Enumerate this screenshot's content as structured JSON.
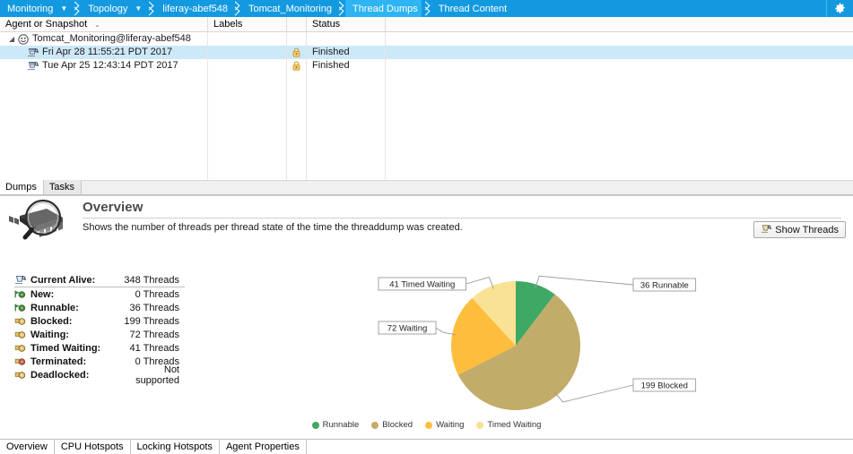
{
  "breadcrumb": {
    "items": [
      {
        "label": "Monitoring",
        "has_caret": true,
        "active": false
      },
      {
        "label": "Topology",
        "has_caret": true,
        "active": false
      },
      {
        "label": "liferay-abef548",
        "has_caret": false,
        "active": false
      },
      {
        "label": "Tomcat_Monitoring",
        "has_caret": false,
        "active": false
      },
      {
        "label": "Thread Dumps",
        "has_caret": false,
        "active": true
      },
      {
        "label": "Thread Content",
        "has_caret": false,
        "active": false
      }
    ],
    "settings_icon": "gear-icon",
    "bar_color": "#1399e0",
    "active_color": "#2eb4f2"
  },
  "table": {
    "columns": [
      "Agent or Snapshot",
      "Labels",
      "",
      "Status",
      ""
    ],
    "rows": [
      {
        "icon": "agent-icon",
        "name": "Tomcat_Monitoring@liferay-abef548",
        "labels": "",
        "lock": "",
        "status": "",
        "level": 0,
        "expanded": true,
        "selected": false
      },
      {
        "icon": "thread-dump-icon",
        "name": "Fri Apr 28 11:55:21 PDT 2017",
        "labels": "",
        "lock": "lock-icon",
        "status": "Finished",
        "level": 1,
        "expanded": false,
        "selected": true
      },
      {
        "icon": "thread-dump-icon",
        "name": "Tue Apr 25 12:43:14 PDT 2017",
        "labels": "",
        "lock": "lock-icon",
        "status": "Finished",
        "level": 1,
        "expanded": false,
        "selected": false
      }
    ],
    "empty_row_count": 8
  },
  "subtabs": [
    {
      "label": "Dumps",
      "active": true
    },
    {
      "label": "Tasks",
      "active": false
    }
  ],
  "overview": {
    "title": "Overview",
    "description": "Shows the number of threads per thread state of the time the threaddump was created.",
    "icon": "cpu-magnifier-icon",
    "show_threads_button": "Show Threads",
    "show_threads_icon": "thread-dump-icon",
    "stats": [
      {
        "icon": "thread-dump-icon",
        "label": "Current Alive:",
        "value": "348 Threads",
        "header": true
      },
      {
        "icon": "thread-new-icon",
        "label": "New:",
        "value": "0 Threads",
        "header": false
      },
      {
        "icon": "thread-runnable-icon",
        "label": "Runnable:",
        "value": "36 Threads",
        "header": false
      },
      {
        "icon": "thread-blocked-icon",
        "label": "Blocked:",
        "value": "199 Threads",
        "header": false
      },
      {
        "icon": "thread-waiting-icon",
        "label": "Waiting:",
        "value": "72 Threads",
        "header": false
      },
      {
        "icon": "thread-timed-icon",
        "label": "Timed Waiting:",
        "value": "41 Threads",
        "header": false
      },
      {
        "icon": "thread-terminated-icon",
        "label": "Terminated:",
        "value": "0 Threads",
        "header": false
      },
      {
        "icon": "thread-deadlock-icon",
        "label": "Deadlocked:",
        "value": "Not supported",
        "header": false
      }
    ]
  },
  "chart_data": {
    "type": "pie",
    "title": "",
    "categories": [
      "Runnable",
      "Blocked",
      "Waiting",
      "Timed Waiting"
    ],
    "values": [
      36,
      199,
      72,
      41
    ],
    "total": 348,
    "colors": [
      "#3fa864",
      "#c2ac6a",
      "#fcbe3c",
      "#fae295"
    ],
    "labels": [
      "36 Runnable",
      "199 Blocked",
      "72 Waiting",
      "41 Timed Waiting"
    ],
    "legend": [
      "Runnable",
      "Blocked",
      "Waiting",
      "Timed Waiting"
    ],
    "legend_position": "bottom",
    "start_angle": 0,
    "direction": "clockwise",
    "grid": false
  },
  "bottom_tabs": [
    {
      "label": "Overview",
      "active": true
    },
    {
      "label": "CPU Hotspots",
      "active": false
    },
    {
      "label": "Locking Hotspots",
      "active": false
    },
    {
      "label": "Agent Properties",
      "active": false
    }
  ]
}
